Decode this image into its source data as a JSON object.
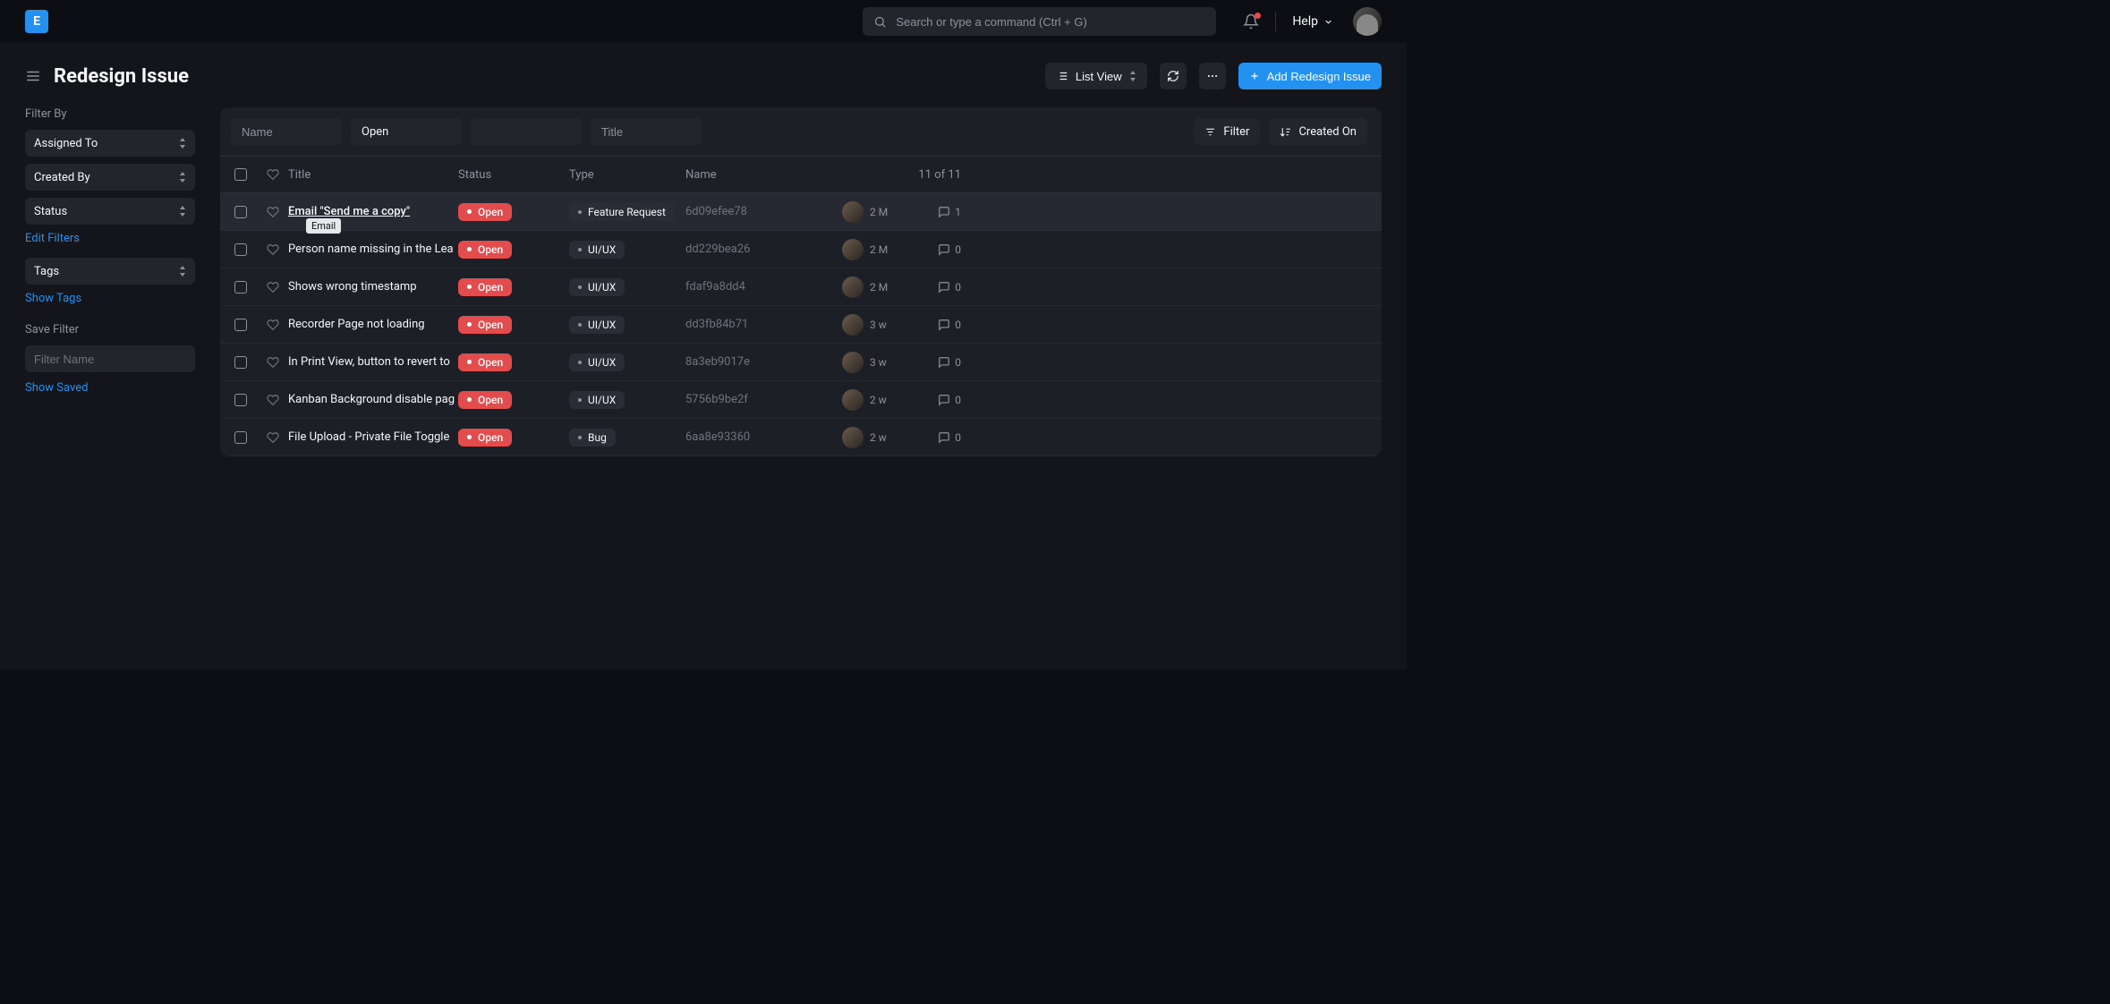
{
  "topbar": {
    "search_placeholder": "Search or type a command (Ctrl + G)",
    "help_label": "Help"
  },
  "page": {
    "title": "Redesign Issue",
    "view_selector": "List View",
    "add_button": "Add Redesign Issue"
  },
  "sidebar": {
    "filter_heading": "Filter By",
    "filters": [
      "Assigned To",
      "Created By",
      "Status"
    ],
    "edit_filters": "Edit Filters",
    "tags_label": "Tags",
    "show_tags": "Show Tags",
    "save_heading": "Save Filter",
    "filter_name_placeholder": "Filter Name",
    "show_saved": "Show Saved"
  },
  "filterbar": {
    "name_placeholder": "Name",
    "status_value": "Open",
    "title_placeholder": "Title",
    "filter_label": "Filter",
    "sort_label": "Created On"
  },
  "columns": {
    "title": "Title",
    "status": "Status",
    "type": "Type",
    "name": "Name",
    "count": "11 of 11"
  },
  "tooltip": "Email",
  "rows": [
    {
      "title": "Email \"Send me a copy\"",
      "status": "Open",
      "type": "Feature Request",
      "name": "6d09efee78",
      "age": "2 M",
      "comments": "1",
      "hovered": true
    },
    {
      "title": "Person name missing in the Lea",
      "status": "Open",
      "type": "UI/UX",
      "name": "dd229bea26",
      "age": "2 M",
      "comments": "0"
    },
    {
      "title": "Shows wrong timestamp",
      "status": "Open",
      "type": "UI/UX",
      "name": "fdaf9a8dd4",
      "age": "2 M",
      "comments": "0"
    },
    {
      "title": "Recorder Page not loading",
      "status": "Open",
      "type": "UI/UX",
      "name": "dd3fb84b71",
      "age": "3 w",
      "comments": "0"
    },
    {
      "title": "In Print View, button to revert to",
      "status": "Open",
      "type": "UI/UX",
      "name": "8a3eb9017e",
      "age": "3 w",
      "comments": "0"
    },
    {
      "title": "Kanban Background disable pag",
      "status": "Open",
      "type": "UI/UX",
      "name": "5756b9be2f",
      "age": "2 w",
      "comments": "0"
    },
    {
      "title": "File Upload - Private File Toggle",
      "status": "Open",
      "type": "Bug",
      "name": "6aa8e93360",
      "age": "2 w",
      "comments": "0"
    }
  ]
}
